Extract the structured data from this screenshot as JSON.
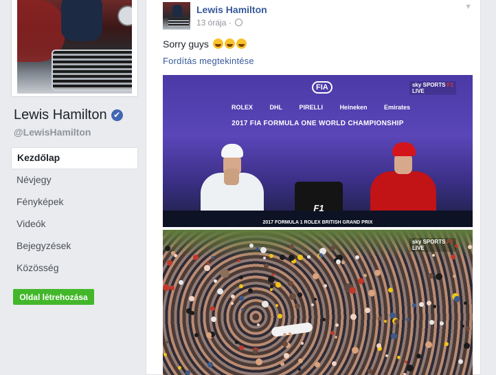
{
  "profile": {
    "name": "Lewis Hamilton",
    "verified_badge": "✔",
    "handle": "@LewisHamilton"
  },
  "nav": {
    "items": [
      {
        "label": "Kezdőlap",
        "active": true
      },
      {
        "label": "Névjegy"
      },
      {
        "label": "Fényképek"
      },
      {
        "label": "Videók"
      },
      {
        "label": "Bejegyzések"
      },
      {
        "label": "Közösség"
      }
    ]
  },
  "create_page_label": "Oldal létrehozása",
  "post": {
    "author": "Lewis Hamilton",
    "time": "13 órája",
    "meta_separator": "·",
    "text": "Sorry guys",
    "emoji_count": 3,
    "translate_label": "Fordítás megtekintése",
    "menu_icon": "chevron-down-icon"
  },
  "photo_1": {
    "fia_logo": "FIA",
    "sponsors": [
      "ROLEX",
      "DHL",
      "PIRELLI",
      "Heineken",
      "Emirates"
    ],
    "title": "2017 FIA FORMULA ONE WORLD CHAMPIONSHIP",
    "f1_logo": "F1",
    "caption": "2017 FORMULA 1 ROLEX BRITISH GRAND PRIX",
    "broadcaster": "sky SPORTS",
    "broadcaster_tag": "F1",
    "broadcaster_sub": "LIVE"
  },
  "photo_2": {
    "broadcaster": "sky SPORTS",
    "broadcaster_tag": "F1",
    "broadcaster_sub": "LIVE"
  },
  "colors": {
    "background": "#e9ebee",
    "link": "#365899",
    "verified": "#4267b2",
    "create_button": "#42b72a"
  }
}
